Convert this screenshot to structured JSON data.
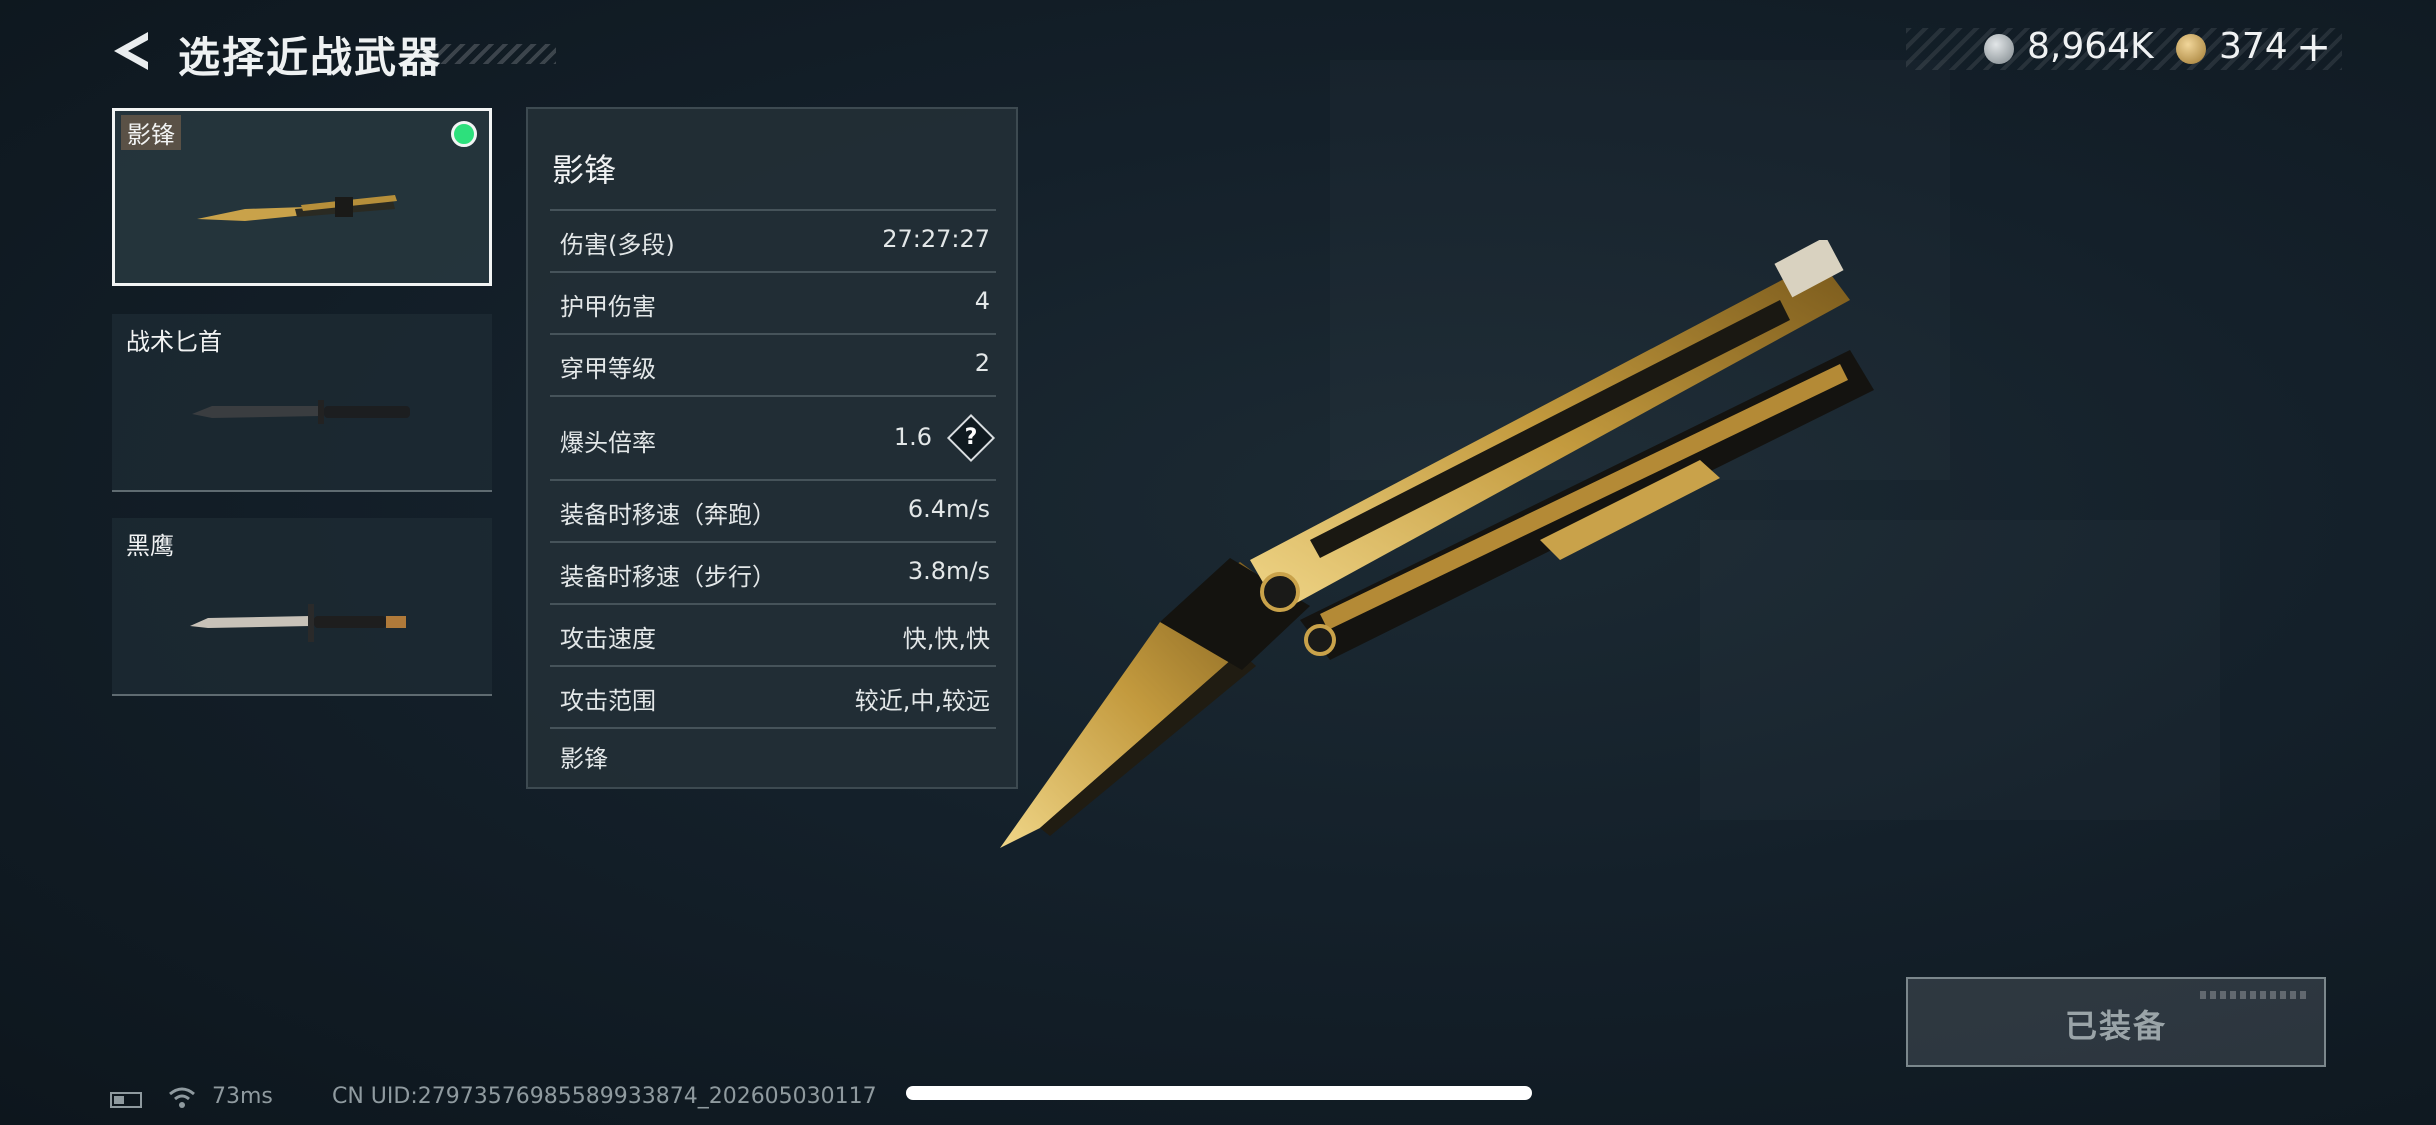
{
  "header": {
    "title": "选择近战武器",
    "back_icon": "chevron-left-icon"
  },
  "currency": {
    "silver_icon": "silver-coin-icon",
    "silver_value": "8,964K",
    "gold_icon": "gold-coin-icon",
    "gold_value": "374",
    "add_label": "+"
  },
  "weapons": [
    {
      "name": "影锋",
      "selected": true,
      "equipped": true
    },
    {
      "name": "战术匕首",
      "selected": false,
      "equipped": false
    },
    {
      "name": "黑鹰",
      "selected": false,
      "equipped": false
    }
  ],
  "stats": {
    "title": "影锋",
    "rows": [
      {
        "label": "伤害(多段)",
        "value": "27:27:27"
      },
      {
        "label": "护甲伤害",
        "value": "4"
      },
      {
        "label": "穿甲等级",
        "value": "2"
      },
      {
        "label": "爆头倍率",
        "value": "1.6",
        "help": "?"
      },
      {
        "label": "装备时移速（奔跑）",
        "value": "6.4m/s"
      },
      {
        "label": "装备时移速（步行）",
        "value": "3.8m/s"
      },
      {
        "label": "攻击速度",
        "value": "快,快,快"
      },
      {
        "label": "攻击范围",
        "value": "较近,中,较远"
      }
    ],
    "footer": "影锋"
  },
  "equip_button": {
    "label": "已装备"
  },
  "status_bar": {
    "ping": "73ms",
    "uid": "CN UID:2797357698558993387​4_202605030117"
  },
  "colors": {
    "equipped_dot": "#2de07c",
    "gold": "#c9a24a",
    "background": "#14202a"
  }
}
